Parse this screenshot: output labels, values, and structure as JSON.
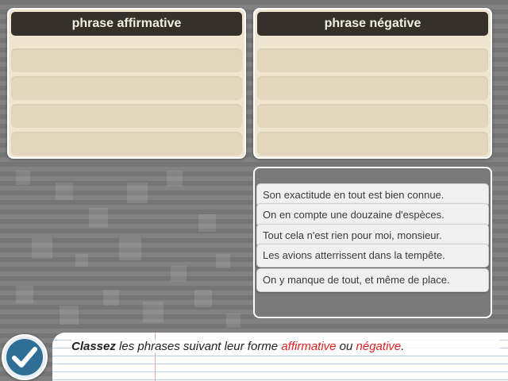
{
  "panels": {
    "affirmative": {
      "title": "phrase affirmative",
      "slot_count": 4
    },
    "negative": {
      "title": "phrase négative",
      "slot_count": 4
    }
  },
  "sentences": [
    "Son exactitude en tout est bien connue.",
    "On en compte une douzaine d'espèces.",
    "Tout cela n'est rien pour moi, monsieur.",
    "Les avions atterrissent dans la tempête.",
    "On y manque de tout, et même de place."
  ],
  "instruction": {
    "verb": "Classez",
    "middle": "les phrases suivant leur forme",
    "word1": "affirmative",
    "connector": "ou",
    "word2": "négative",
    "end": "."
  },
  "colors": {
    "highlight": "#e02020",
    "header_bg": "#35302a",
    "panel_bg": "#efe5d0",
    "check_button": "#2f6f96"
  },
  "icons": {
    "check": "checkmark-icon"
  }
}
